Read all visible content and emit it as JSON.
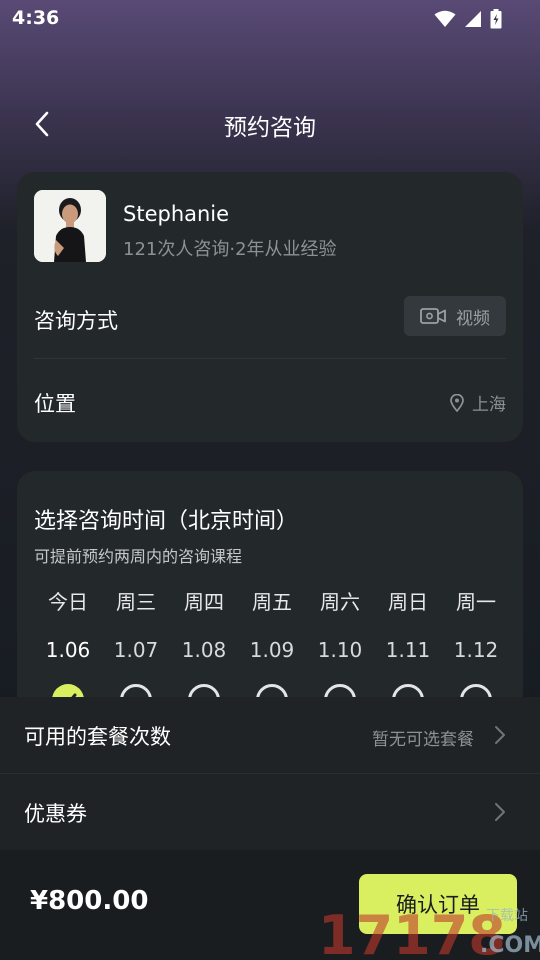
{
  "status_bar": {
    "time": "4:36"
  },
  "nav": {
    "title": "预约咨询"
  },
  "advisor": {
    "name": "Stephanie",
    "meta": "121次人咨询·2年从业经验"
  },
  "consult": {
    "label": "咨询方式",
    "mode": "视频",
    "mode_icon": "video-camera-icon"
  },
  "location": {
    "label": "位置",
    "value": "上海",
    "icon": "location-pin-icon"
  },
  "schedule": {
    "title": "选择咨询时间（北京时间）",
    "subtitle": "可提前预约两周内的咨询课程",
    "days": [
      {
        "name": "今日",
        "date": "1.06",
        "selected": true
      },
      {
        "name": "周三",
        "date": "1.07",
        "selected": false
      },
      {
        "name": "周四",
        "date": "1.08",
        "selected": false
      },
      {
        "name": "周五",
        "date": "1.09",
        "selected": false
      },
      {
        "name": "周六",
        "date": "1.10",
        "selected": false
      },
      {
        "name": "周日",
        "date": "1.11",
        "selected": false
      },
      {
        "name": "周一",
        "date": "1.12",
        "selected": false
      }
    ]
  },
  "package": {
    "label": "可用的套餐次数",
    "value": "暂无可选套餐"
  },
  "coupon": {
    "label": "优惠券"
  },
  "footer": {
    "price": "¥800.00",
    "confirm_label": "确认订单"
  },
  "watermark": {
    "text": "17178",
    "suffix": ".COM",
    "tag": "下载站"
  },
  "colors": {
    "accent": "#d9ef5f",
    "card": "#23282b",
    "sheet": "#1f2326"
  }
}
